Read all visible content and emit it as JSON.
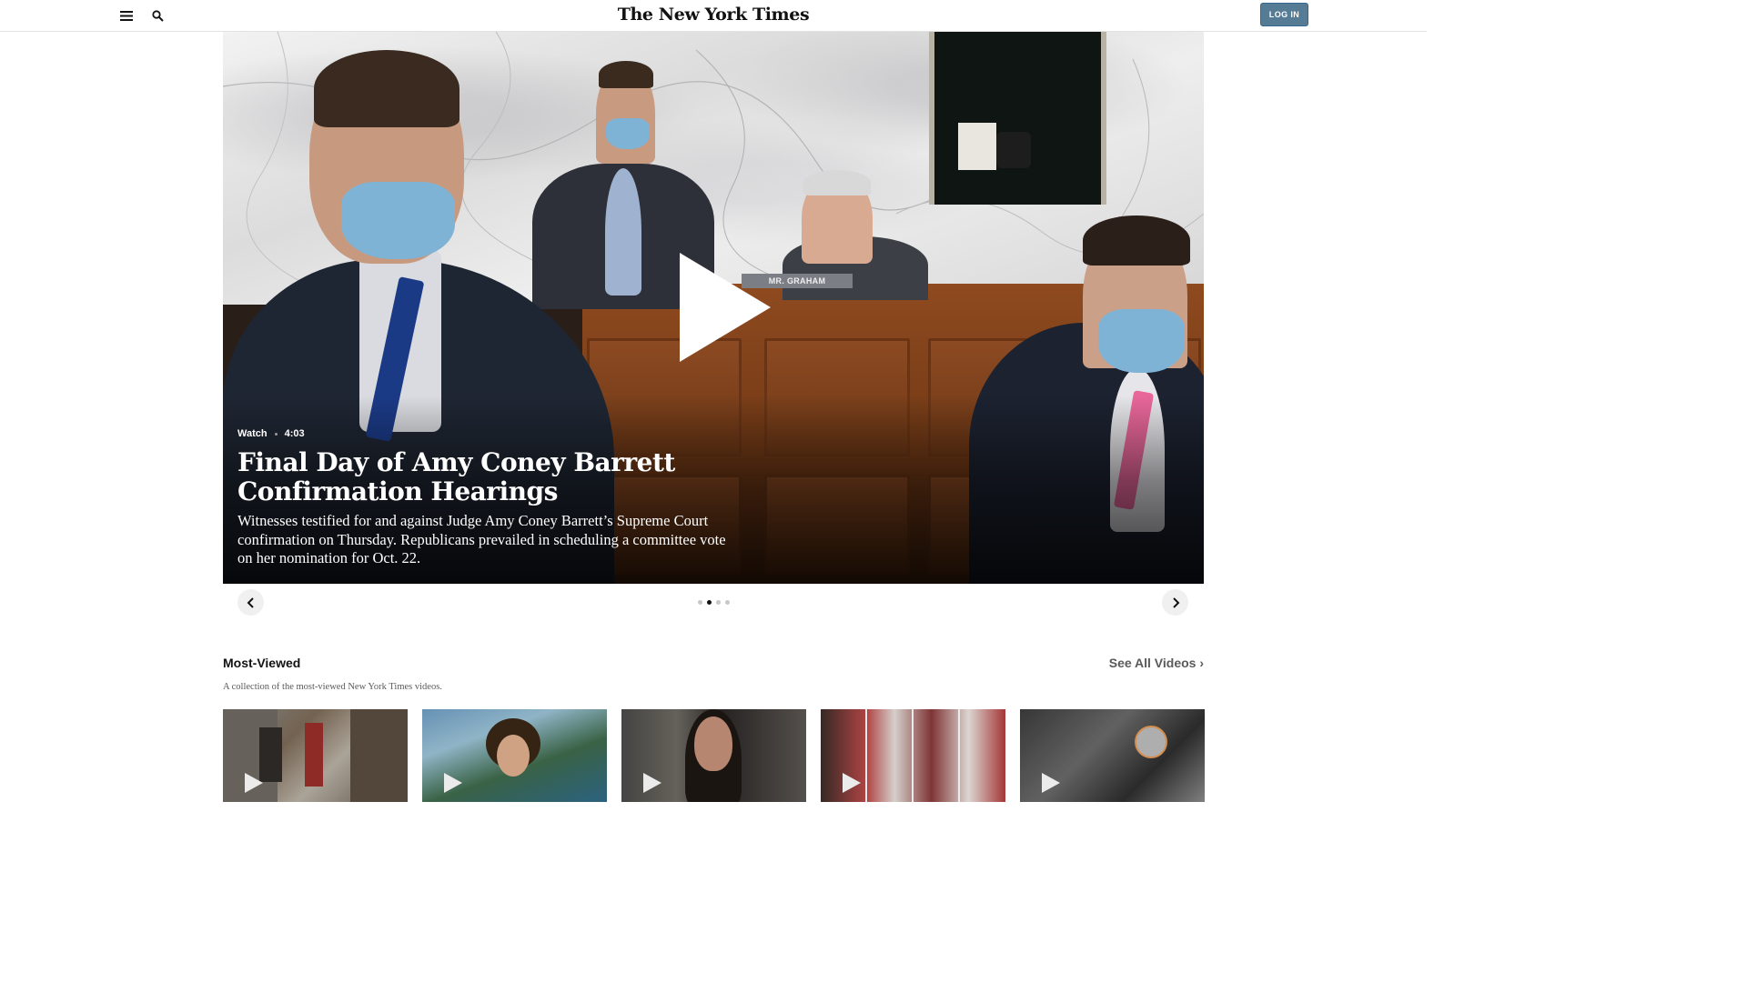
{
  "header": {
    "logo": "The New York Times",
    "login_label": "LOG IN"
  },
  "hero": {
    "meta_label": "Watch",
    "duration": "4:03",
    "title": "Final Day of Amy Coney Barrett Confirmation Hearings",
    "summary": "Witnesses testified for and against Judge Amy Coney Barrett’s Supreme Court confirmation on Thursday. Republicans prevailed in scheduling a committee vote on her nomination for Oct. 22.",
    "nameplate": "MR. GRAHAM"
  },
  "carousel": {
    "dot_count": 4,
    "active_index": 1
  },
  "most_viewed": {
    "title": "Most-Viewed",
    "see_all": "See All Videos ›",
    "description": "A collection of the most-viewed New York Times videos."
  },
  "colors": {
    "login_bg": "#567b95",
    "text_primary": "#121212",
    "text_secondary": "#5a5a5a"
  },
  "icons": [
    "menu-icon",
    "search-icon",
    "play-icon",
    "chevron-left-icon",
    "chevron-right-icon"
  ]
}
